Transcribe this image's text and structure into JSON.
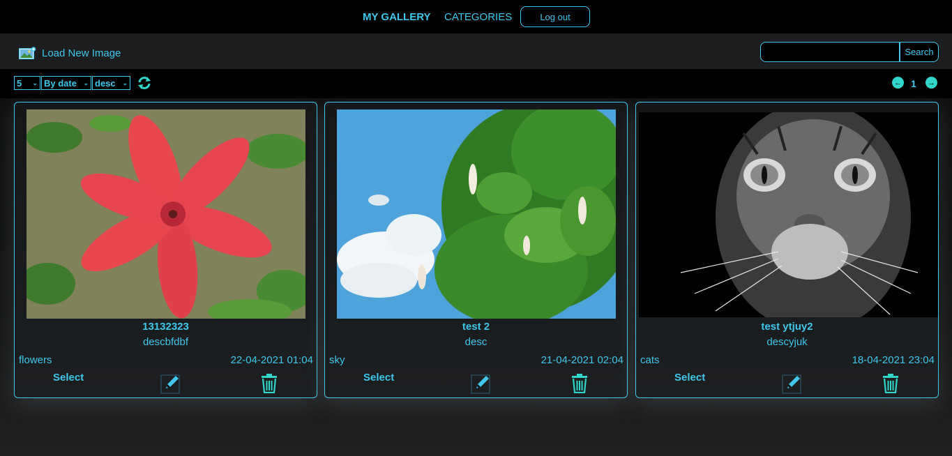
{
  "nav": {
    "gallery": "MY GALLERY",
    "categories": "CATEGORIES",
    "logout": "Log out"
  },
  "toolbar": {
    "load_label": "Load New Image",
    "load_icon": "image-add-icon",
    "search_value": "",
    "search_label": "Search"
  },
  "controls": {
    "page_size": "5",
    "sort_by": "By date",
    "order": "desc",
    "refresh_icon": "refresh-icon",
    "page": "1"
  },
  "cards": [
    {
      "title": "13132323",
      "desc": "descbfdbf",
      "category": "flowers",
      "date": "22-04-2021 01:04",
      "select": "Select",
      "image": "red-lily-flower"
    },
    {
      "title": "test 2",
      "desc": "desc",
      "category": "sky",
      "date": "21-04-2021 02:04",
      "select": "Select",
      "image": "chestnut-tree-sky"
    },
    {
      "title": "test ytjuy2",
      "desc": "descyjuk",
      "category": "cats",
      "date": "18-04-2021 23:04",
      "select": "Select",
      "image": "black-white-cat"
    }
  ],
  "colors": {
    "accent": "#3fc7ec",
    "teal": "#2fd6c9",
    "background": "#0b0c0d"
  }
}
